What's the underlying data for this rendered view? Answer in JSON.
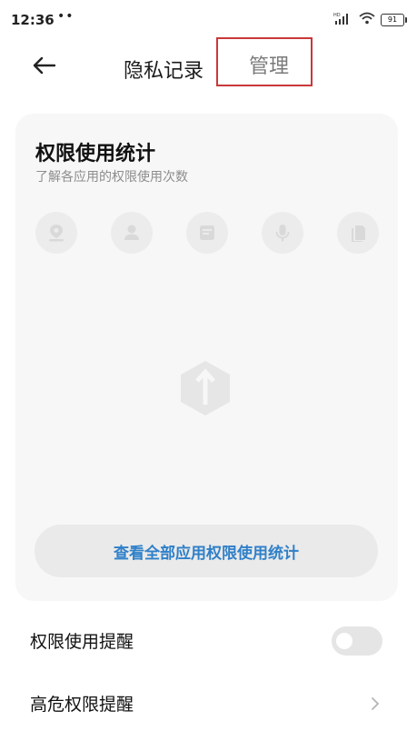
{
  "status_bar": {
    "time": "12:36",
    "dots": "••",
    "network": "HD",
    "battery": "91"
  },
  "header": {
    "back_icon": "arrow-left-icon",
    "title": "隐私记录",
    "manage_label": "管理"
  },
  "stats_card": {
    "title": "权限使用统计",
    "subtitle": "了解各应用的权限使用次数",
    "permission_icons": [
      "location-icon",
      "contacts-icon",
      "messages-icon",
      "microphone-icon",
      "storage-icon"
    ],
    "view_all_label": "查看全部应用权限使用统计",
    "accent_color": "#2f80c9"
  },
  "settings": {
    "usage_reminder_label": "权限使用提醒",
    "usage_reminder_enabled": false,
    "high_risk_reminder_label": "高危权限提醒"
  }
}
